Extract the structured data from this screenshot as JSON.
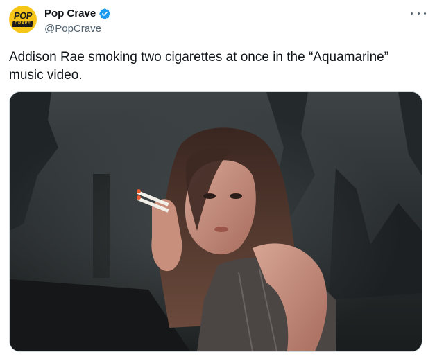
{
  "author": {
    "display_name": "Pop Crave",
    "handle": "@PopCrave",
    "verified": true,
    "avatar_logo_top": "POP",
    "avatar_logo_bottom": "CRAVE",
    "avatar_color": "#f5c518"
  },
  "more_icon": "more-horizontal-icon",
  "tweet": {
    "text": "Addison Rae smoking two cigarettes at once in the “Aquamarine” music video."
  },
  "colors": {
    "text_primary": "#0f1419",
    "text_secondary": "#536471",
    "verified_blue": "#1d9bf0"
  }
}
